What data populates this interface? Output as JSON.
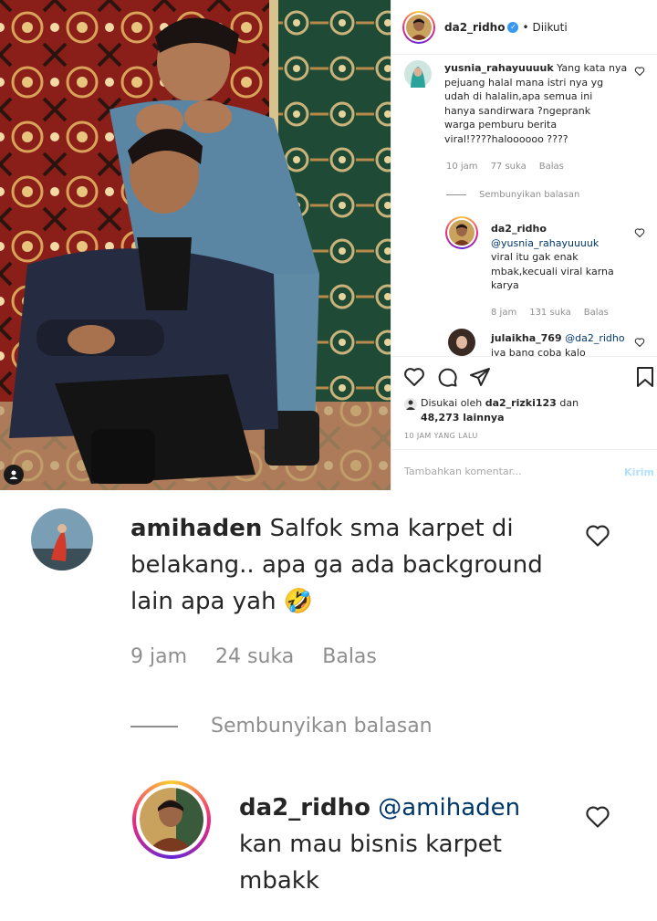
{
  "post": {
    "header": {
      "username": "da2_ridho",
      "verified_glyph": "✓",
      "dot": "•",
      "follow_state": "Diikuti"
    },
    "comments": [
      {
        "username": "yusnia_rahayuuuuk",
        "lines": [
          "Yang kata nya",
          "pejuang halal mana istri nya yg",
          "udah di halalin,apa semua ini",
          "hanya sandirwara ?ngeprank",
          "warga pemburu berita",
          "viral!????haloooooo ????"
        ],
        "time": "10 jam",
        "likes": "77 suka",
        "reply": "Balas",
        "hide_replies": "Sembunyikan balasan"
      },
      {
        "username": "da2_ridho",
        "mention": "@yusnia_rahayuuuuk",
        "lines": [
          "viral itu gak enak",
          "mbak,kecuali viral karna",
          "karya"
        ],
        "time": "8 jam",
        "likes": "131 suka",
        "reply": "Balas"
      },
      {
        "username": "julaikha_769",
        "mention": "@da2_ridho",
        "lines": [
          "iya bang coba kalo"
        ]
      }
    ],
    "likes_prefix": "Disukai oleh",
    "likes_user": "da2_rizki123",
    "likes_mid": "dan",
    "likes_count": "48,273 lainnya",
    "time_ago": "10 JAM YANG LALU",
    "add_comment_placeholder": "Tambahkan komentar...",
    "post_button": "Kirim"
  },
  "zoom": {
    "comment": {
      "username": "amihaden",
      "lines": [
        "Salfok sma karpet di",
        "belakang.. apa ga ada background",
        "lain apa yah"
      ],
      "emoji": "🤣",
      "time": "9 jam",
      "likes": "24 suka",
      "reply": "Balas",
      "hide_replies": "Sembunyikan balasan"
    },
    "reply": {
      "username": "da2_ridho",
      "mention": "@amihaden",
      "lines": [
        "kan mau bisnis karpet",
        "mbakk"
      ]
    }
  },
  "colors": {
    "link": "#00376b",
    "meta": "#8e8e8e",
    "verified": "#3897f0",
    "post_button": "#b2dffc"
  },
  "icons": [
    "heart-icon",
    "comment-icon",
    "share-icon",
    "bookmark-icon",
    "verified-icon",
    "user-tag-icon"
  ]
}
